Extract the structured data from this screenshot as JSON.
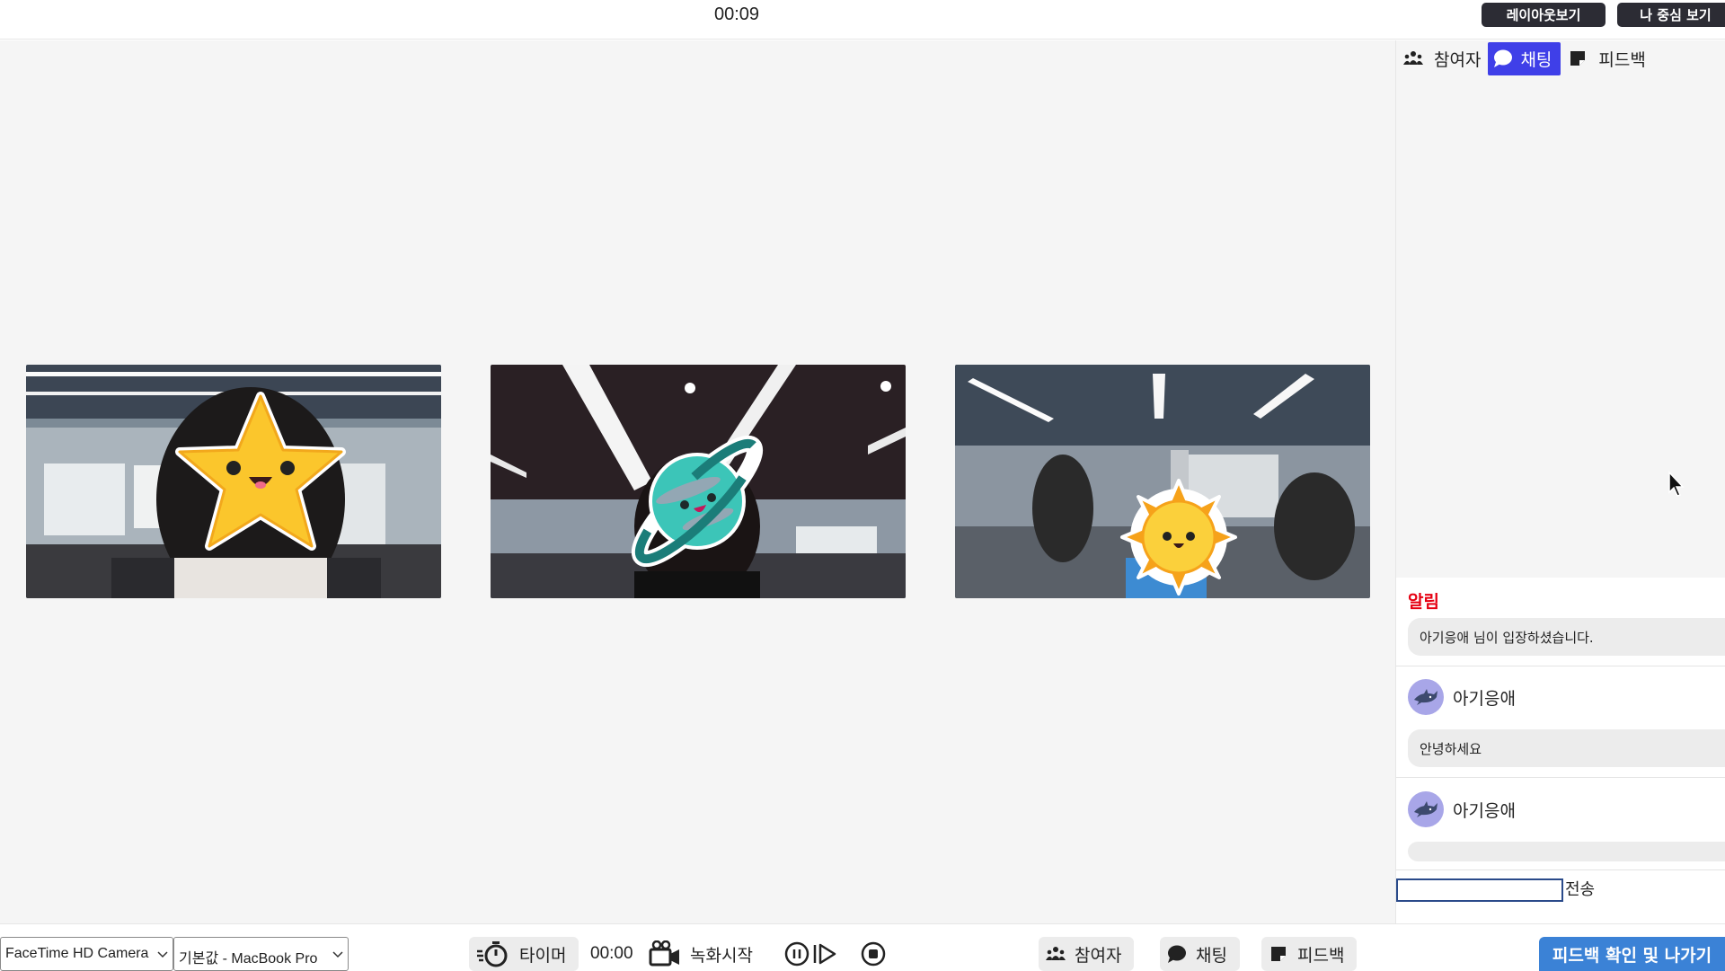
{
  "header": {
    "elapsed_time": "00:09",
    "layout_view_label": "레이아웃보기",
    "self_view_label": "나 중심 보기"
  },
  "video_tiles": [
    {
      "sticker": "star-sticker"
    },
    {
      "sticker": "planet-sticker"
    },
    {
      "sticker": "sun-sticker"
    }
  ],
  "sidepanel": {
    "tabs": [
      {
        "label": "참여자",
        "icon": "participants-icon"
      },
      {
        "label": "채팅",
        "icon": "chat-icon",
        "active": true
      },
      {
        "label": "피드백",
        "icon": "feedback-icon"
      }
    ],
    "chat": {
      "notice_title": "알림",
      "notice_text": "아기응애 님이 입장하셨습니다.",
      "messages": [
        {
          "sender": "아기응애",
          "text": "안녕하세요"
        },
        {
          "sender": "아기응애",
          "text": ""
        }
      ],
      "input_value": "",
      "send_label": "전송"
    }
  },
  "bottombar": {
    "camera_select": "FaceTime HD Camera",
    "mic_select": "기본값 - MacBook Pro",
    "timer_label": "타이머",
    "record_time": "00:00",
    "record_label": "녹화시작",
    "participants_label": "참여자",
    "chat_label": "채팅",
    "feedback_label": "피드백",
    "exit_label": "피드백 확인 및 나가기"
  },
  "colors": {
    "accent_tab": "#3f3fe8",
    "alert_red": "#e60012",
    "exit_button": "#3b82d6",
    "top_button": "#2c2c34"
  }
}
